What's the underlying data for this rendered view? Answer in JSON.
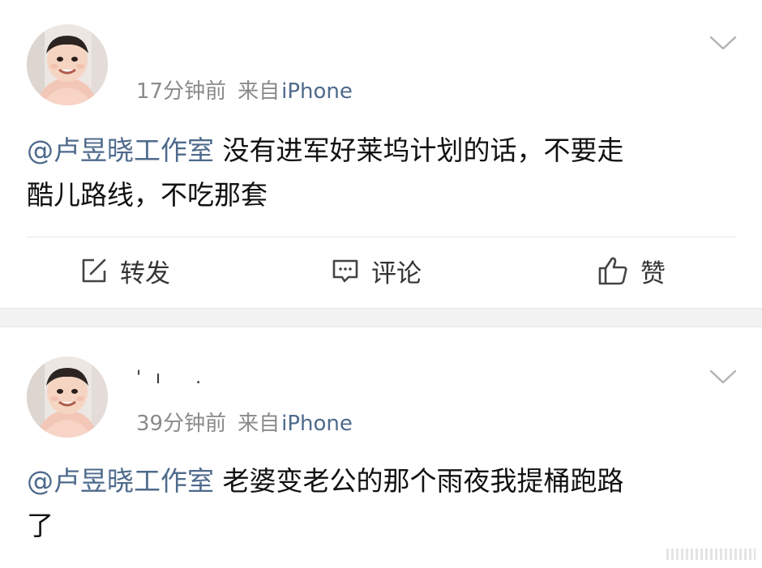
{
  "posts": [
    {
      "avatar": "avatar-child-photo",
      "username": "",
      "time": "17分钟前",
      "source_prefix": "来自",
      "source_app": "iPhone",
      "mention": "@卢昱晓工作室",
      "text_line1": " 没有进军好莱坞计划的话，不要走",
      "text_line2": "酷儿路线，不吃那套",
      "actions": {
        "repost": "转发",
        "comment": "评论",
        "like": "赞"
      }
    },
    {
      "avatar": "avatar-child-photo",
      "username": "'ı   .",
      "time": "39分钟前",
      "source_prefix": "来自",
      "source_app": "iPhone",
      "mention": "@卢昱晓工作室",
      "text_line1": " 老婆变老公的那个雨夜我提桶跑路",
      "text_line2": "了"
    }
  ],
  "icons": {
    "repost": "edit-square-icon",
    "comment": "comment-bubble-icon",
    "like": "thumbs-up-icon",
    "menu": "chevron-down-icon"
  },
  "colors": {
    "link": "#4e6a8c",
    "meta": "#8a8a8a",
    "separator": "#f2f2f2"
  }
}
